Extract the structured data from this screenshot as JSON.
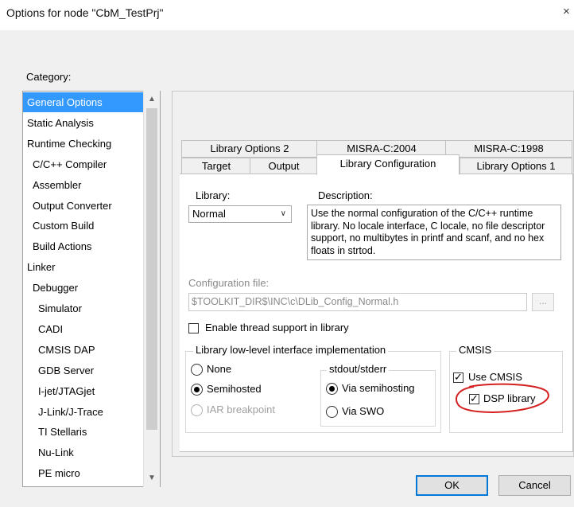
{
  "window": {
    "title": "Options for node \"CbM_TestPrj\"",
    "close_glyph": "×"
  },
  "category": {
    "label": "Category:",
    "items": [
      {
        "label": "General Options",
        "selected": true
      },
      {
        "label": "Static Analysis"
      },
      {
        "label": "Runtime Checking"
      },
      {
        "label": "C/C++ Compiler"
      },
      {
        "label": "Assembler"
      },
      {
        "label": "Output Converter"
      },
      {
        "label": "Custom Build"
      },
      {
        "label": "Build Actions"
      },
      {
        "label": "Linker"
      },
      {
        "label": "Debugger"
      },
      {
        "label": "Simulator"
      },
      {
        "label": "CADI"
      },
      {
        "label": "CMSIS DAP"
      },
      {
        "label": "GDB Server"
      },
      {
        "label": "I-jet/JTAGjet"
      },
      {
        "label": "J-Link/J-Trace"
      },
      {
        "label": "TI Stellaris"
      },
      {
        "label": "Nu-Link"
      },
      {
        "label": "PE micro"
      }
    ]
  },
  "tabs": {
    "back_row": [
      "Library Options 2",
      "MISRA-C:2004",
      "MISRA-C:1998"
    ],
    "front_row": [
      "Target",
      "Output",
      "Library Configuration",
      "Library Options 1"
    ],
    "active": "Library Configuration"
  },
  "library": {
    "label": "Library:",
    "value": "Normal",
    "description_label": "Description:",
    "description": "Use the normal configuration of the C/C++ runtime library. No locale interface, C locale, no file descriptor support, no multibytes in printf and scanf, and no hex floats in strtod."
  },
  "config_file": {
    "label": "Configuration file:",
    "value": "$TOOLKIT_DIR$\\INC\\c\\DLib_Config_Normal.h",
    "browse_label": "..."
  },
  "thread_support": {
    "label": "Enable thread support in library",
    "checked": false
  },
  "low_level": {
    "title": "Library low-level interface implementation",
    "options": [
      "None",
      "Semihosted",
      "IAR breakpoint"
    ],
    "selected": "Semihosted"
  },
  "stdout": {
    "title": "stdout/stderr",
    "options": [
      "Via semihosting",
      "Via SWO"
    ],
    "selected": "Via semihosting"
  },
  "cmsis": {
    "title": "CMSIS",
    "use_cmsis": {
      "label": "Use CMSIS",
      "checked": true
    },
    "dsp_library": {
      "label": "DSP library",
      "checked": true
    },
    "annotation_color": "#d42020"
  },
  "buttons": {
    "ok": "OK",
    "cancel": "Cancel"
  }
}
